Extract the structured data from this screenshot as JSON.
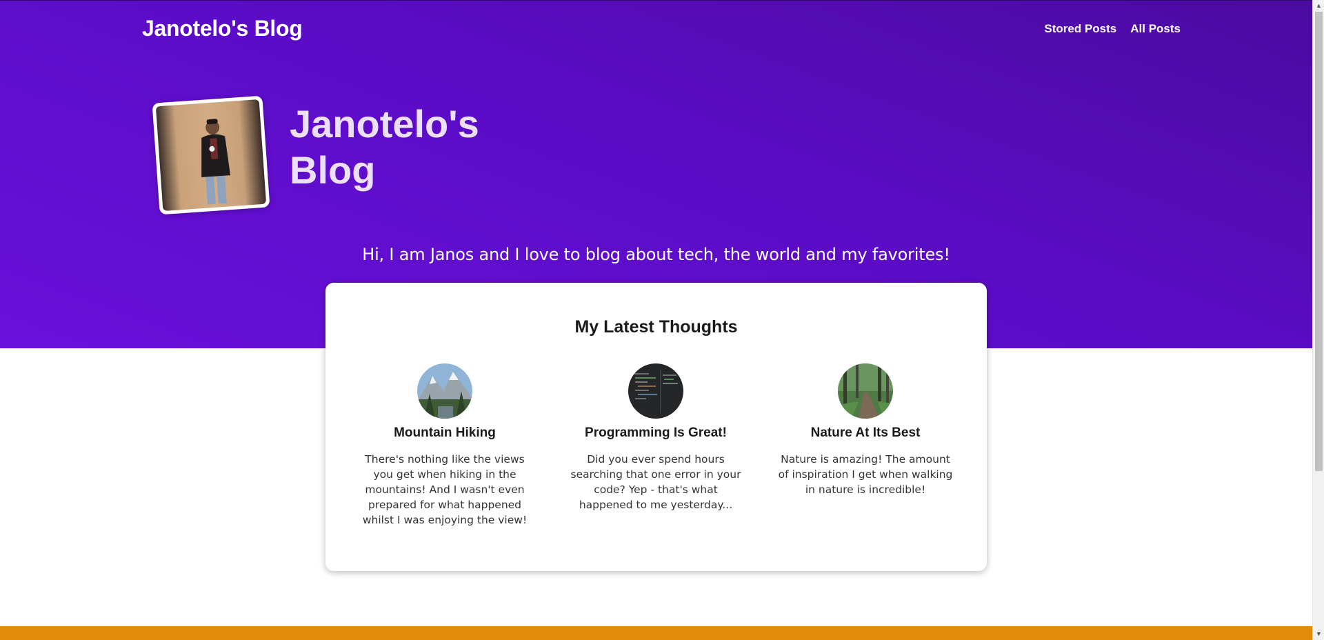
{
  "header": {
    "site_title": "Janotelo's Blog",
    "nav": [
      {
        "label": "Stored Posts"
      },
      {
        "label": "All Posts"
      }
    ]
  },
  "hero": {
    "title_line1": "Janotelo's",
    "title_line2": "Blog",
    "tagline": "Hi, I am Janos and I love to blog about tech, the world and my favorites!"
  },
  "latest": {
    "heading": "My Latest Thoughts",
    "posts": [
      {
        "title": "Mountain Hiking",
        "excerpt": "There's nothing like the views you get when hiking in the mountains! And I wasn't even prepared for what happened whilst I was enjoying the view!",
        "thumb_icon": "mountain-landscape-image"
      },
      {
        "title": "Programming Is Great!",
        "excerpt": "Did you ever spend hours searching that one error in your code? Yep - that's what happened to me yesterday...",
        "thumb_icon": "code-editor-image"
      },
      {
        "title": "Nature At Its Best",
        "excerpt": "Nature is amazing! The amount of inspiration I get when walking in nature is incredible!",
        "thumb_icon": "forest-path-image"
      }
    ]
  },
  "colors": {
    "hero_gradient_start": "#4a0ba0",
    "hero_gradient_end": "#6a10dc",
    "footer_accent": "#e38a0c",
    "hero_title": "#ecdff8"
  }
}
